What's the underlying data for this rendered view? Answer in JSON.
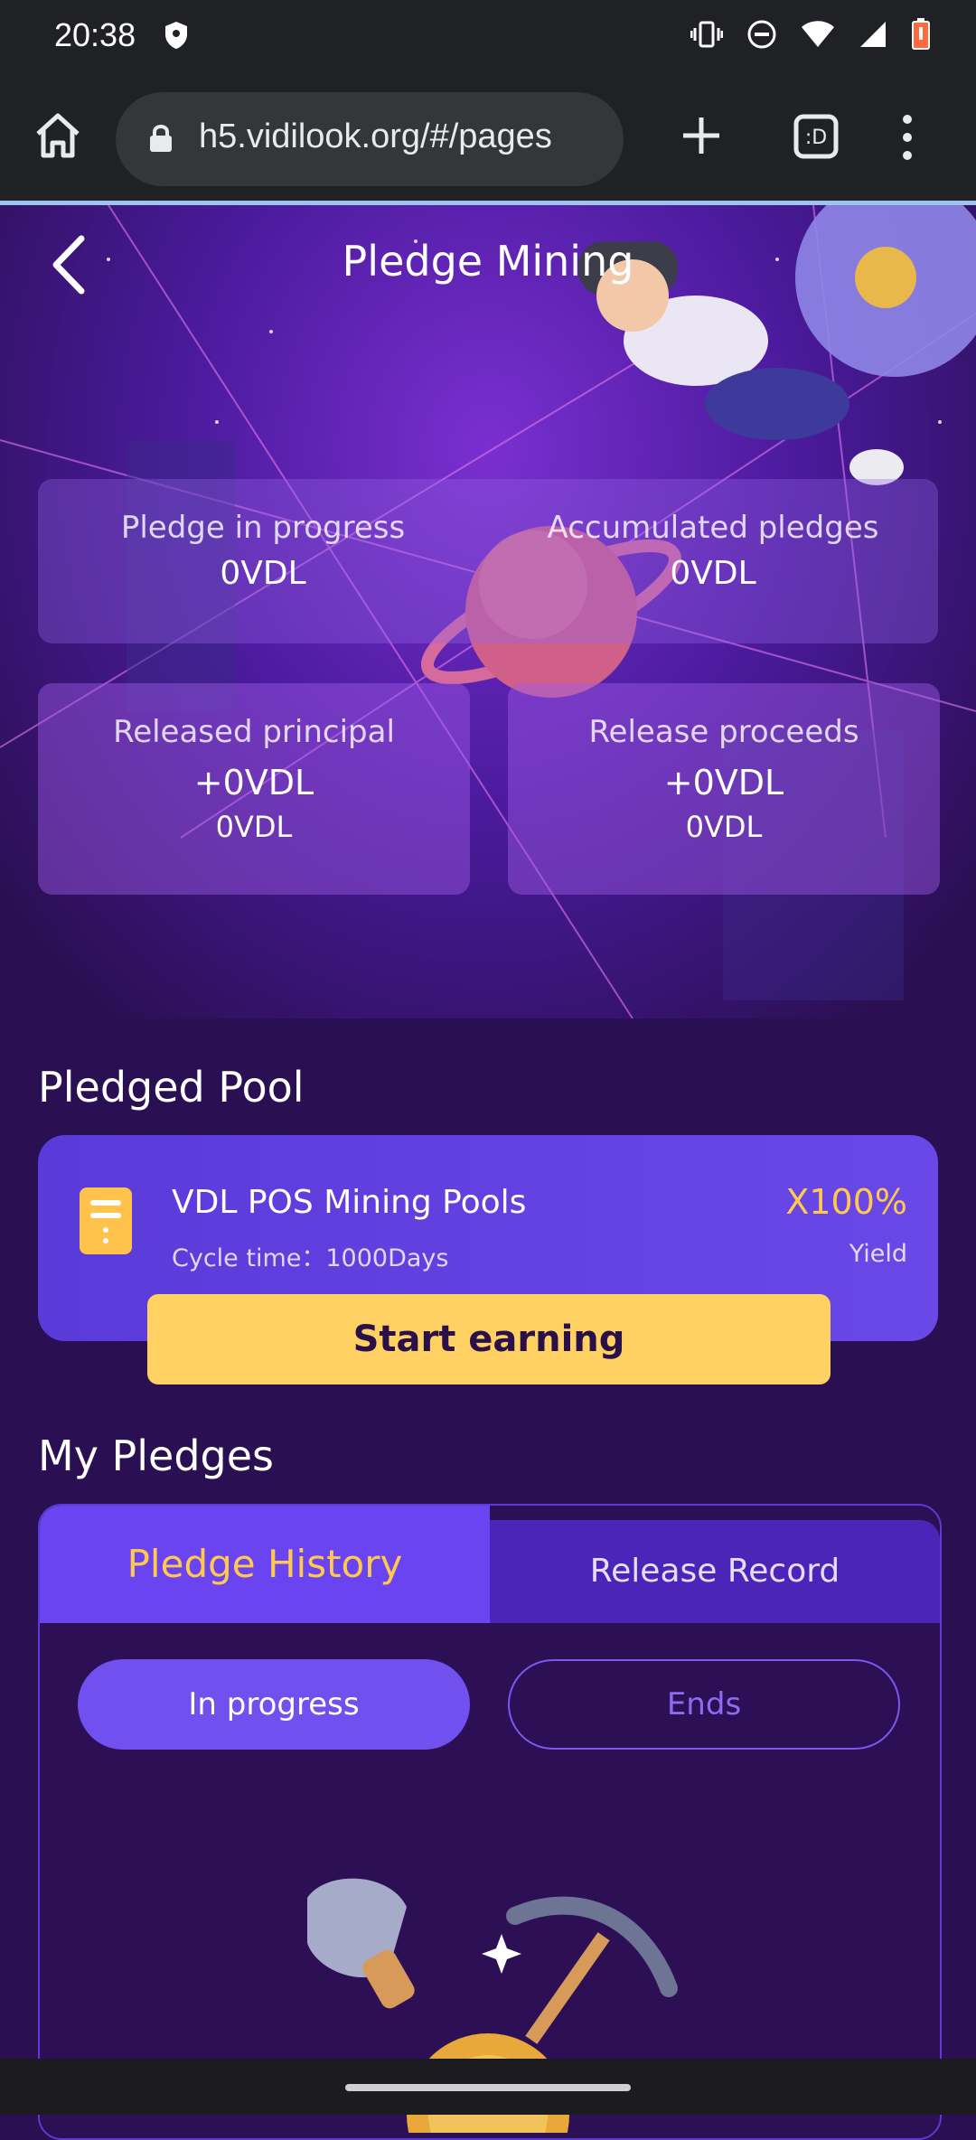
{
  "status_bar": {
    "time": "20:38"
  },
  "browser": {
    "url": "h5.vidilook.org/#/pages"
  },
  "header": {
    "title": "Pledge Mining"
  },
  "summary": {
    "pledge_in_progress": {
      "label": "Pledge in progress",
      "value": "0VDL"
    },
    "accumulated_pledges": {
      "label": "Accumulated pledges",
      "value": "0VDL"
    },
    "released_principal": {
      "label": "Released principal",
      "value": "+0VDL",
      "sub": "0VDL"
    },
    "release_proceeds": {
      "label": "Release proceeds",
      "value": "+0VDL",
      "sub": "0VDL"
    }
  },
  "pledged_pool": {
    "title": "Pledged Pool",
    "name": "VDL POS Mining Pools",
    "cycle": "Cycle time：1000Days",
    "yield_value": "X100%",
    "yield_label": "Yield",
    "button": "Start earning"
  },
  "my_pledges": {
    "title": "My Pledges",
    "tabs": [
      {
        "label": "Pledge History",
        "active": true
      },
      {
        "label": "Release Record",
        "active": false
      }
    ],
    "filters": [
      {
        "label": "In progress",
        "active": true
      },
      {
        "label": "Ends",
        "active": false
      }
    ]
  },
  "colors": {
    "accent": "#6a44f0",
    "highlight": "#ffc94e",
    "button": "#ffd163"
  }
}
